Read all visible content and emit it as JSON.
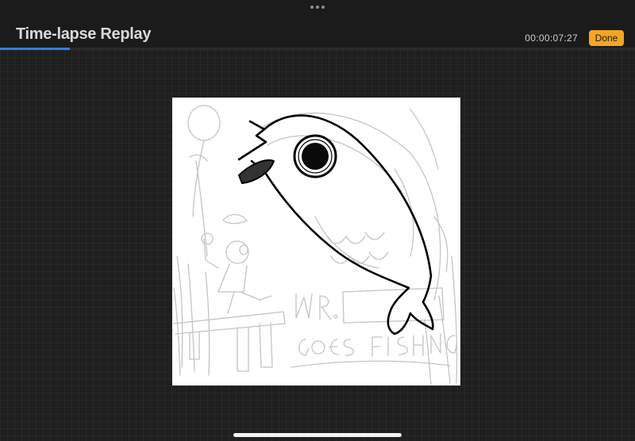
{
  "header": {
    "title": "Time-lapse Replay",
    "timestamp": "00:00:07:27",
    "done_label": "Done"
  },
  "playback": {
    "progress": 0.11
  },
  "icons": {
    "more": "more-dots-icon"
  },
  "colors": {
    "background": "#1f1f1f",
    "accent_progress": "#3a7be0",
    "done_button": "#f4a623",
    "canvas": "#ffffff"
  }
}
